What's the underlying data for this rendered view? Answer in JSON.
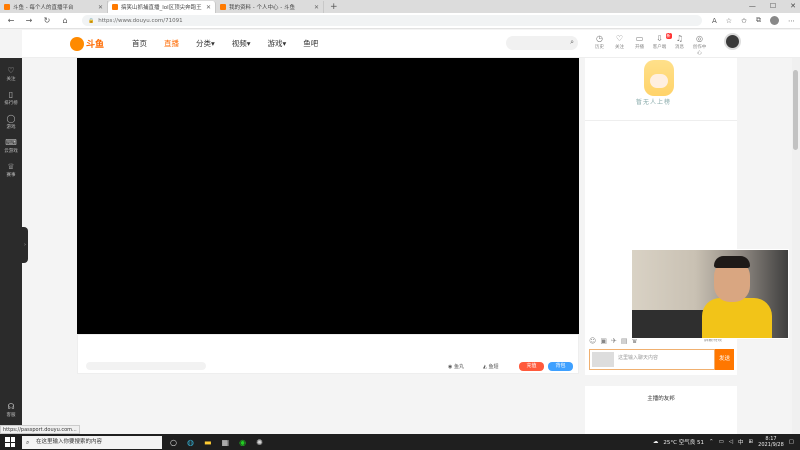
{
  "browser": {
    "tabs": [
      {
        "title": "斗鱼 - 每个人的直播平台",
        "active": false
      },
      {
        "title": "搞笑山抓捕直播_lol区顶尖奔跑王",
        "active": true
      },
      {
        "title": "我的资料 - 个人中心 - 斗鱼",
        "active": false
      }
    ],
    "new_tab": "+",
    "url": "https://www.douyu.com/71091",
    "status_url": "https://passport.douyu.com..."
  },
  "site": {
    "logo_text": "斗鱼",
    "nav": [
      "首页",
      "直播",
      "分类",
      "视频",
      "游戏",
      "鱼吧"
    ],
    "active_nav": "直播",
    "header_icons": [
      {
        "label": "历史",
        "icon": "clock-icon"
      },
      {
        "label": "关注",
        "icon": "heart-icon"
      },
      {
        "label": "开播",
        "icon": "camera-icon"
      },
      {
        "label": "客户端",
        "icon": "download-icon"
      },
      {
        "label": "消息",
        "icon": "bell-icon"
      },
      {
        "label": "创作中心",
        "icon": "bulb-icon"
      }
    ],
    "client_badge": "新"
  },
  "sidebar": {
    "items": [
      {
        "label": "关注",
        "icon": "heart-icon"
      },
      {
        "label": "排行榜",
        "icon": "trophy-icon"
      },
      {
        "label": "游戏",
        "icon": "gamepad-icon"
      },
      {
        "label": "云游戏",
        "icon": "controller-icon"
      },
      {
        "label": "赛事",
        "icon": "cup-icon"
      }
    ],
    "bottom": {
      "label": "客服",
      "icon": "headset-icon"
    }
  },
  "player": {
    "actions": [
      "鱼丸",
      "鱼翅"
    ],
    "btn_recharge": "充值",
    "btn_backpack": "背包"
  },
  "right": {
    "mascot_caption": "暂无人上榜",
    "chat_placeholder": "这里输入聊天内容",
    "send": "发送",
    "shield": "屏蔽特效",
    "fans_title": "主播的友邦"
  },
  "taskbar": {
    "search_placeholder": "在这里输入你要搜索的内容",
    "weather": "25°C 空气良 51",
    "time": "8:17",
    "date": "2021/9/28",
    "ime": "中"
  },
  "colors": {
    "accent": "#ff7700",
    "sidebar": "#2b2b2b"
  }
}
